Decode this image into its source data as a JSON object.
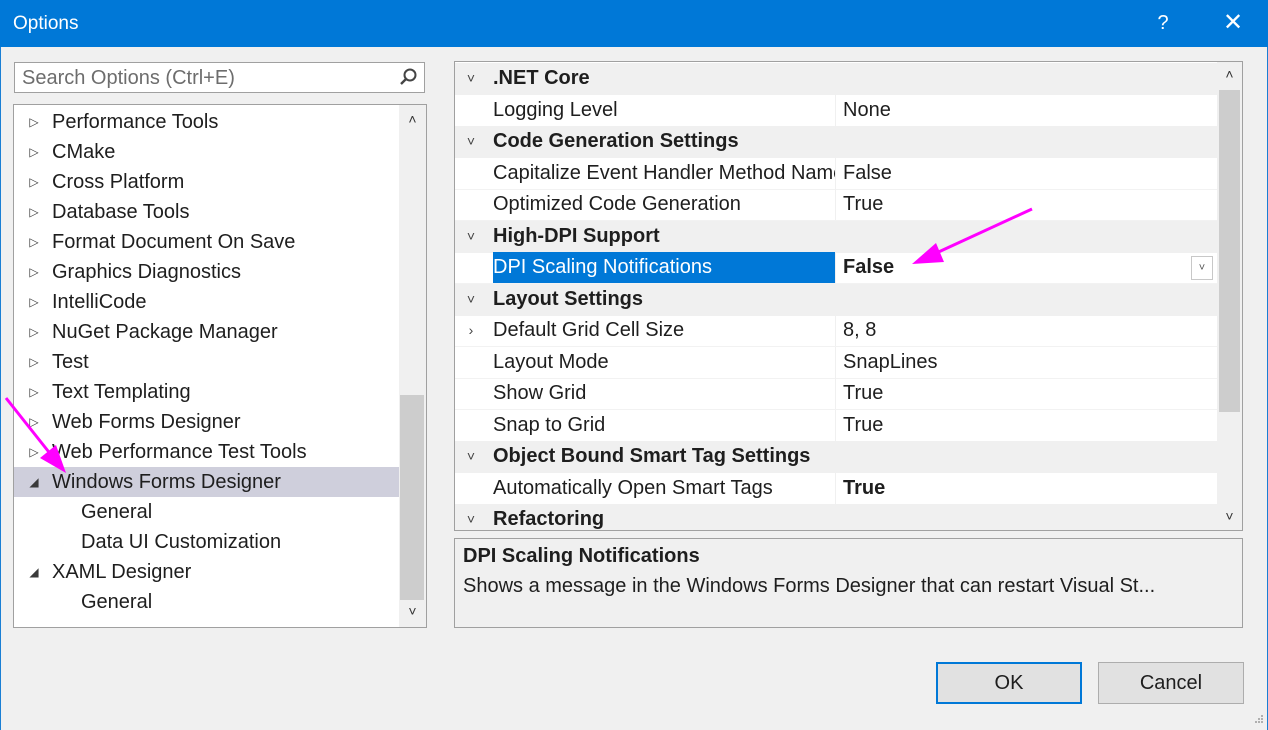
{
  "window": {
    "title": "Options",
    "help_glyph": "?",
    "close_glyph": "✕"
  },
  "search": {
    "placeholder": "Search Options (Ctrl+E)"
  },
  "tree": {
    "items": [
      {
        "label": "Performance Tools",
        "expander": "▷",
        "level": 0,
        "selected": false
      },
      {
        "label": "CMake",
        "expander": "▷",
        "level": 0,
        "selected": false
      },
      {
        "label": "Cross Platform",
        "expander": "▷",
        "level": 0,
        "selected": false
      },
      {
        "label": "Database Tools",
        "expander": "▷",
        "level": 0,
        "selected": false
      },
      {
        "label": "Format Document On Save",
        "expander": "▷",
        "level": 0,
        "selected": false
      },
      {
        "label": "Graphics Diagnostics",
        "expander": "▷",
        "level": 0,
        "selected": false
      },
      {
        "label": "IntelliCode",
        "expander": "▷",
        "level": 0,
        "selected": false
      },
      {
        "label": "NuGet Package Manager",
        "expander": "▷",
        "level": 0,
        "selected": false
      },
      {
        "label": "Test",
        "expander": "▷",
        "level": 0,
        "selected": false
      },
      {
        "label": "Text Templating",
        "expander": "▷",
        "level": 0,
        "selected": false
      },
      {
        "label": "Web Forms Designer",
        "expander": "▷",
        "level": 0,
        "selected": false
      },
      {
        "label": "Web Performance Test Tools",
        "expander": "▷",
        "level": 0,
        "selected": false
      },
      {
        "label": "Windows Forms Designer",
        "expander": "◢",
        "level": 0,
        "selected": true
      },
      {
        "label": "General",
        "expander": "",
        "level": 1,
        "selected": false
      },
      {
        "label": "Data UI Customization",
        "expander": "",
        "level": 1,
        "selected": false
      },
      {
        "label": "XAML Designer",
        "expander": "◢",
        "level": 0,
        "selected": false
      },
      {
        "label": "General",
        "expander": "",
        "level": 1,
        "selected": false
      }
    ]
  },
  "properties": {
    "rows": [
      {
        "type": "category",
        "name": ".NET Core",
        "chevron": "˅"
      },
      {
        "type": "prop",
        "name": "Logging Level",
        "value": "None",
        "bold": false,
        "selected": false,
        "chevron": ""
      },
      {
        "type": "category",
        "name": "Code Generation Settings",
        "chevron": "˅"
      },
      {
        "type": "prop",
        "name": "Capitalize Event Handler Method Name",
        "value": "False",
        "bold": false,
        "selected": false,
        "chevron": ""
      },
      {
        "type": "prop",
        "name": "Optimized Code Generation",
        "value": "True",
        "bold": false,
        "selected": false,
        "chevron": ""
      },
      {
        "type": "category",
        "name": "High-DPI Support",
        "chevron": "˅"
      },
      {
        "type": "prop",
        "name": "DPI Scaling Notifications",
        "value": "False",
        "bold": true,
        "selected": true,
        "chevron": "",
        "dropdown": "˅"
      },
      {
        "type": "category",
        "name": "Layout Settings",
        "chevron": "˅"
      },
      {
        "type": "prop",
        "name": "Default Grid Cell Size",
        "value": "8, 8",
        "bold": false,
        "selected": false,
        "chevron": "›"
      },
      {
        "type": "prop",
        "name": "Layout Mode",
        "value": "SnapLines",
        "bold": false,
        "selected": false,
        "chevron": ""
      },
      {
        "type": "prop",
        "name": "Show Grid",
        "value": "True",
        "bold": false,
        "selected": false,
        "chevron": ""
      },
      {
        "type": "prop",
        "name": "Snap to Grid",
        "value": "True",
        "bold": false,
        "selected": false,
        "chevron": ""
      },
      {
        "type": "category",
        "name": "Object Bound Smart Tag Settings",
        "chevron": "˅"
      },
      {
        "type": "prop",
        "name": "Automatically Open Smart Tags",
        "value": "True",
        "bold": true,
        "selected": false,
        "chevron": ""
      },
      {
        "type": "category",
        "name": "Refactoring",
        "chevron": "˅"
      }
    ]
  },
  "description": {
    "title": "DPI Scaling Notifications",
    "text": "Shows a message in the Windows Forms Designer that can restart Visual St..."
  },
  "buttons": {
    "ok": "OK",
    "cancel": "Cancel"
  },
  "colors": {
    "titlebar": "#0078d7",
    "selection": "#0078d7",
    "tree_selection": "#cfcfdc",
    "annotation_arrow": "#ff00ff"
  }
}
